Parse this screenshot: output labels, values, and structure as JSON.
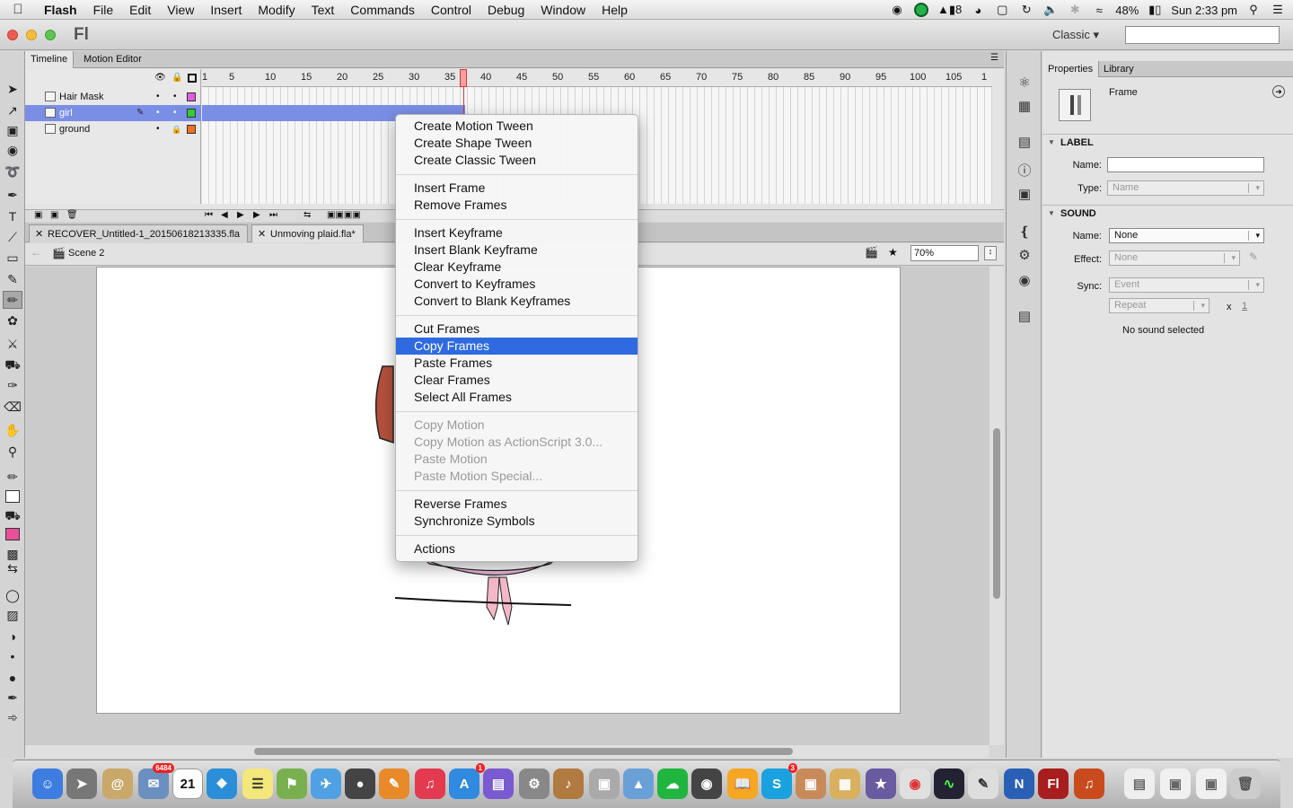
{
  "menubar": {
    "apple": "",
    "items": [
      "Flash",
      "File",
      "Edit",
      "View",
      "Insert",
      "Modify",
      "Text",
      "Commands",
      "Control",
      "Debug",
      "Window",
      "Help"
    ],
    "status": {
      "adobe_count": "8",
      "battery": "48%",
      "clock": "Sun 2:33 pm"
    }
  },
  "window": {
    "logo": "Fl",
    "workspace": "Classic"
  },
  "timeline": {
    "tabs": [
      "Timeline",
      "Motion Editor"
    ],
    "layers": [
      {
        "name": "Hair Mask",
        "color": "#e05ce0"
      },
      {
        "name": "girl",
        "color": "#33cc33"
      },
      {
        "name": "ground",
        "color": "#f07020"
      }
    ],
    "ruler": [
      "1",
      "5",
      "10",
      "15",
      "20",
      "25",
      "30",
      "35",
      "40",
      "45",
      "50",
      "55",
      "60",
      "65",
      "70",
      "75",
      "80",
      "85",
      "90",
      "95",
      "100",
      "105",
      "1"
    ]
  },
  "documents": {
    "tabs": [
      "RECOVER_Untitled-1_20150618213335.fla",
      "Unmoving plaid.fla*"
    ],
    "scene": "Scene 2",
    "zoom": "70%"
  },
  "context_menu": {
    "groups": [
      [
        "Create Motion Tween",
        "Create Shape Tween",
        "Create Classic Tween"
      ],
      [
        "Insert Frame",
        "Remove Frames"
      ],
      [
        "Insert Keyframe",
        "Insert Blank Keyframe",
        "Clear Keyframe",
        "Convert to Keyframes",
        "Convert to Blank Keyframes"
      ],
      [
        "Cut Frames",
        "Copy Frames",
        "Paste Frames",
        "Clear Frames",
        "Select All Frames"
      ],
      [
        "Copy Motion",
        "Copy Motion as ActionScript 3.0...",
        "Paste Motion",
        "Paste Motion Special..."
      ],
      [
        "Reverse Frames",
        "Synchronize Symbols"
      ],
      [
        "Actions"
      ]
    ],
    "highlighted": "Copy Frames",
    "disabled": [
      "Copy Motion",
      "Copy Motion as ActionScript 3.0...",
      "Paste Motion",
      "Paste Motion Special..."
    ]
  },
  "properties": {
    "tabs": [
      "Properties",
      "Library"
    ],
    "object_type": "Frame",
    "label_section": "LABEL",
    "name_label": "Name:",
    "name_value": "",
    "type_label": "Type:",
    "type_value": "Name",
    "sound_section": "SOUND",
    "sound_name_label": "Name:",
    "sound_name_value": "None",
    "effect_label": "Effect:",
    "effect_value": "None",
    "sync_label": "Sync:",
    "sync_value": "Event",
    "repeat_value": "Repeat",
    "repeat_x": "x",
    "repeat_count": "1",
    "no_sound": "No sound selected"
  },
  "dock": {
    "calendar_day": "21",
    "badges": {
      "mail": "6484",
      "appstore": "1",
      "skype": "3"
    }
  }
}
